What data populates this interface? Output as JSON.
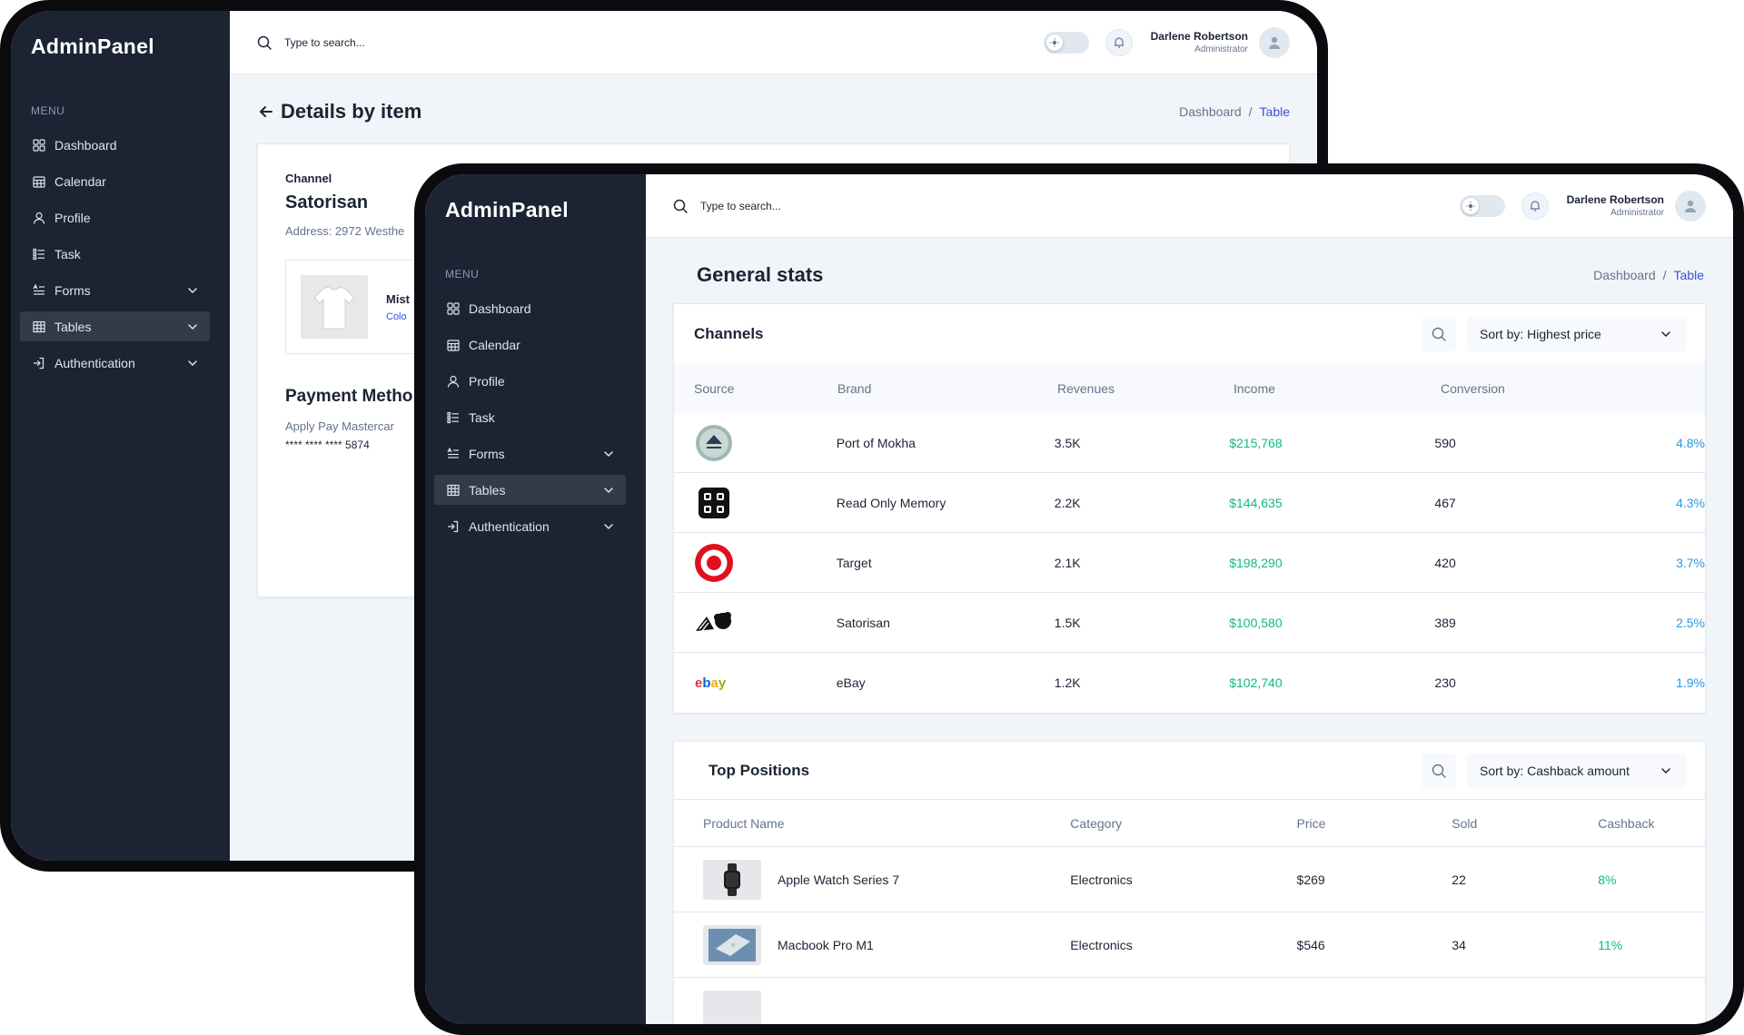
{
  "app": {
    "brand": "AdminPanel",
    "menu_title": "MENU"
  },
  "nav": [
    {
      "label": "Dashboard",
      "icon": "grid-icon",
      "chevron": false,
      "active": false
    },
    {
      "label": "Calendar",
      "icon": "calendar-icon",
      "chevron": false,
      "active": false
    },
    {
      "label": "Profile",
      "icon": "user-icon",
      "chevron": false,
      "active": false
    },
    {
      "label": "Task",
      "icon": "list-icon",
      "chevron": false,
      "active": false
    },
    {
      "label": "Forms",
      "icon": "forms-icon",
      "chevron": true,
      "active": false
    },
    {
      "label": "Tables",
      "icon": "table-icon",
      "chevron": true,
      "active": true
    },
    {
      "label": "Authentication",
      "icon": "login-icon",
      "chevron": true,
      "active": false
    }
  ],
  "topbar": {
    "search_placeholder": "Type to search...",
    "user_name": "Darlene Robertson",
    "user_role": "Administrator"
  },
  "breadcrumb": {
    "home": "Dashboard",
    "separator": "/",
    "current": "Table"
  },
  "back": {
    "page_title": "Details by item",
    "channel_label": "Channel",
    "channel_name": "Satorisan",
    "address": "Address: 2972 Westhe",
    "product_name": "Mist",
    "product_color": "Colo",
    "payment_title": "Payment Metho",
    "payment_methods": "Apply Pay  Mastercar",
    "card_number": "**** **** **** 5874"
  },
  "front": {
    "page_title": "General stats",
    "channels": {
      "title": "Channels",
      "sort_label": "Sort by: Highest price",
      "columns": [
        "Source",
        "Brand",
        "Revenues",
        "Income",
        "Conversion"
      ],
      "rows": [
        {
          "logo": "porto-mokha-logo",
          "brand": "Port of Mokha",
          "revenues": "3.5K",
          "income": "$215,768",
          "conversion": "590",
          "rate": "4.8%"
        },
        {
          "logo": "read-only-memory-logo",
          "brand": "Read Only Memory",
          "revenues": "2.2K",
          "income": "$144,635",
          "conversion": "467",
          "rate": "4.3%"
        },
        {
          "logo": "target-logo",
          "brand": "Target",
          "revenues": "2.1K",
          "income": "$198,290",
          "conversion": "420",
          "rate": "3.7%"
        },
        {
          "logo": "satorisan-logo",
          "brand": "Satorisan",
          "revenues": "1.5K",
          "income": "$100,580",
          "conversion": "389",
          "rate": "2.5%"
        },
        {
          "logo": "ebay-logo",
          "brand": "eBay",
          "revenues": "1.2K",
          "income": "$102,740",
          "conversion": "230",
          "rate": "1.9%"
        }
      ]
    },
    "top_positions": {
      "title": "Top Positions",
      "sort_label": "Sort by: Cashback amount",
      "columns": [
        "Product Name",
        "Category",
        "Price",
        "Sold",
        "Cashback"
      ],
      "rows": [
        {
          "thumb": "apple-watch-thumb",
          "name": "Apple Watch Series 7",
          "category": "Electronics",
          "price": "$269",
          "sold": "22",
          "cashback": "8%"
        },
        {
          "thumb": "macbook-thumb",
          "name": "Macbook Pro M1",
          "category": "Electronics",
          "price": "$546",
          "sold": "34",
          "cashback": "11%"
        }
      ]
    }
  },
  "colors": {
    "sidebar_bg": "#1c2434",
    "accent_blue": "#3c50e0",
    "income_green": "#10b981",
    "rate_blue": "#259ae6",
    "page_bg": "#f1f5f9"
  }
}
